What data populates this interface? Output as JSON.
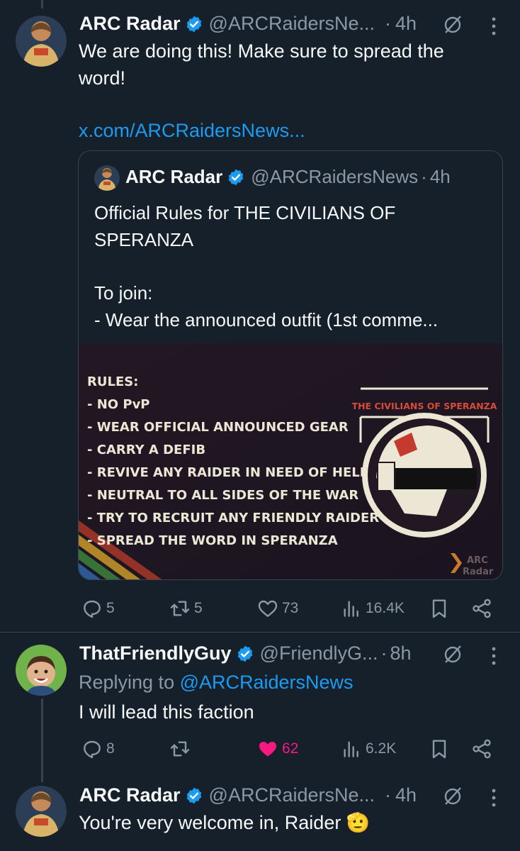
{
  "tweets": [
    {
      "name": "ARC Radar",
      "handle": "@ARCRaidersNe...",
      "dot": "·",
      "time": "4h",
      "text": "We are doing this! Make sure to spread the word!",
      "link": "x.com/ARCRaidersNews...",
      "quote": {
        "name": "ARC Radar",
        "handle": "@ARCRaidersNews",
        "dot": "·",
        "time": "4h",
        "text_line1": "Official Rules for THE CIVILIANS OF",
        "text_line2": "SPERANZA",
        "text_line3": "To join:",
        "text_line4": "- Wear the announced outfit (1st comme...",
        "image": {
          "rules_title": "RULES:",
          "rules": [
            "- NO PvP",
            "- WEAR OFFICIAL ANNOUNCED GEAR",
            "- CARRY A DEFIB",
            "- REVIVE ANY RAIDER IN NEED OF HELP",
            "- NEUTRAL TO ALL SIDES OF THE WAR",
            "- TRY TO RECRUIT ANY FRIENDLY RAIDER",
            "- SPREAD THE WORD IN SPERANZA"
          ],
          "banner": "THE CIVILIANS OF SPERANZA",
          "watermark_line1": "ARC",
          "watermark_line2": "Radar"
        }
      },
      "stats": {
        "replies": "5",
        "reposts": "5",
        "likes": "73",
        "views": "16.4K"
      }
    },
    {
      "name": "ThatFriendlyGuy",
      "handle": "@FriendlyG...",
      "dot": "·",
      "time": "8h",
      "replying_prefix": "Replying to ",
      "replying_to": "@ARCRaidersNews",
      "text": "I will lead this faction",
      "stats": {
        "replies": "8",
        "reposts": "",
        "likes": "62",
        "views": "6.2K"
      },
      "liked": true
    },
    {
      "name": "ARC Radar",
      "handle": "@ARCRaidersNe...",
      "dot": "·",
      "time": "4h",
      "text": "You're very welcome in, Raider",
      "emoji": "🫡"
    }
  ],
  "colors": {
    "background": "#15202b",
    "accent": "#1d9bf0",
    "muted": "#8b98a5",
    "like": "#f91880",
    "border": "#38444d"
  }
}
